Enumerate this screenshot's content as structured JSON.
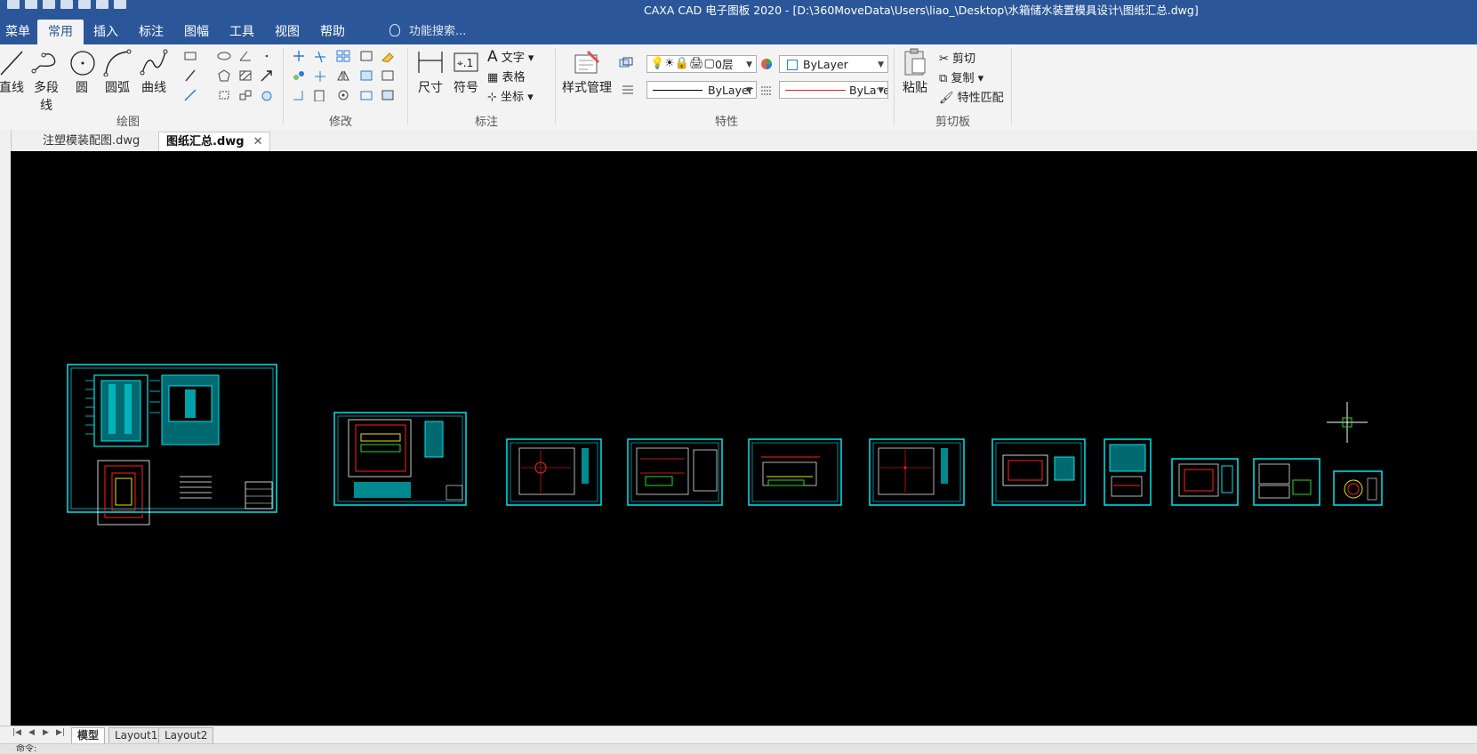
{
  "window": {
    "title": "CAXA CAD 电子图板 2020 - [D:\\360MoveData\\Users\\liao_\\Desktop\\水箱储水装置模具设计\\图纸汇总.dwg]"
  },
  "menu": {
    "items": [
      "菜单",
      "常用",
      "插入",
      "标注",
      "图幅",
      "工具",
      "视图",
      "帮助"
    ],
    "active": "常用",
    "search_label": "功能搜索..."
  },
  "ribbon": {
    "draw": {
      "label": "绘图",
      "line": "直线",
      "polyline": "多段线",
      "circle": "圆",
      "arc": "圆弧",
      "curve": "曲线"
    },
    "modify": {
      "label": "修改"
    },
    "annotate": {
      "label": "标注",
      "dimension": "尺寸",
      "symbol": "符号",
      "text": "文字",
      "table": "表格",
      "coordinate": "坐标"
    },
    "properties": {
      "label": "特性",
      "style_manager": "样式管理",
      "layer_value": "0层",
      "color_value": "ByLayer",
      "linetype_value": "ByLayer",
      "lineweight_value": "ByLayer"
    },
    "clipboard": {
      "label": "剪切板",
      "paste": "粘贴",
      "cut": "剪切",
      "copy": "复制",
      "match": "特性匹配"
    }
  },
  "doc_tabs": [
    {
      "label": "注塑模装配图.dwg",
      "active": false
    },
    {
      "label": "图纸汇总.dwg",
      "active": true
    }
  ],
  "layout_tabs": [
    "模型",
    "Layout1",
    "Layout2"
  ],
  "command_prompt": "命令:",
  "colors": {
    "accent": "#2b579a",
    "drawing_frame": "#00e5ee",
    "drawing_red": "#ff2020",
    "drawing_green": "#22dd22",
    "drawing_yellow": "#e8e800"
  }
}
